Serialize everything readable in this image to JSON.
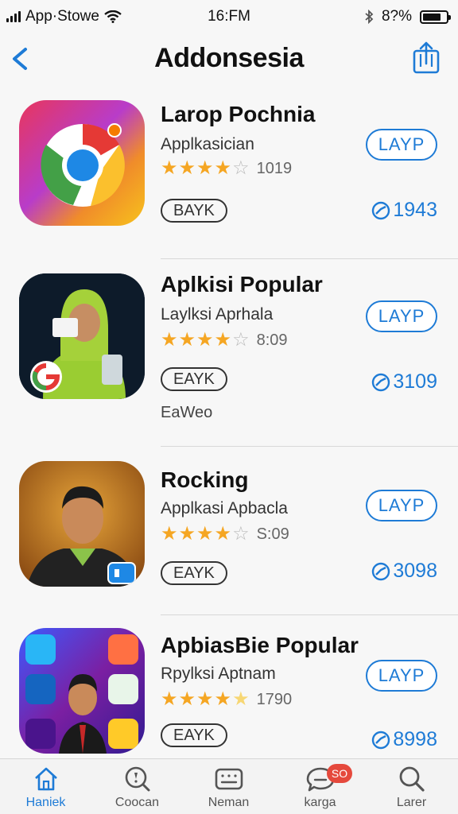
{
  "status": {
    "carrier": "App·Stowe",
    "time": "16:FM",
    "battery": "8?%"
  },
  "nav": {
    "title": "Addonsesia"
  },
  "apps": [
    {
      "title": "Larop Pochnia",
      "subtitle": "Applkasician",
      "rating_value": 4,
      "rating_count": "1019",
      "tag": "BAYK",
      "extra": "",
      "button": "LAYP",
      "downloads": "1943"
    },
    {
      "title": "Aplkisi Popular",
      "subtitle": "Laylksi Aprhala",
      "rating_value": 4,
      "rating_count": "8:09",
      "tag": "EAYK",
      "extra": "EaWeo",
      "button": "LAYP",
      "downloads": "3109"
    },
    {
      "title": "Rocking",
      "subtitle": "Applkasi Apbacla",
      "rating_value": 4,
      "rating_count": "S:09",
      "tag": "EAYK",
      "extra": "",
      "button": "LAYP",
      "downloads": "3098"
    },
    {
      "title": "ApbiasBie Popular",
      "subtitle": "Rpylksi Aptnam",
      "rating_value": 4.5,
      "rating_count": "1790",
      "tag": "EAYK",
      "extra": "",
      "button": "LAYP",
      "downloads": "8998"
    }
  ],
  "tabbar": {
    "items": [
      {
        "label": "Haniek",
        "icon": "home-icon",
        "active": true
      },
      {
        "label": "Coocan",
        "icon": "compass-search-icon",
        "active": false
      },
      {
        "label": "Neman",
        "icon": "keyboard-icon",
        "active": false
      },
      {
        "label": "karga",
        "icon": "chat-bubble-icon",
        "active": false,
        "badge": "SO"
      },
      {
        "label": "Larer",
        "icon": "search-icon",
        "active": false
      }
    ]
  },
  "colors": {
    "accent": "#1e7bd6",
    "star": "#f5a623",
    "badge": "#e5493c"
  }
}
